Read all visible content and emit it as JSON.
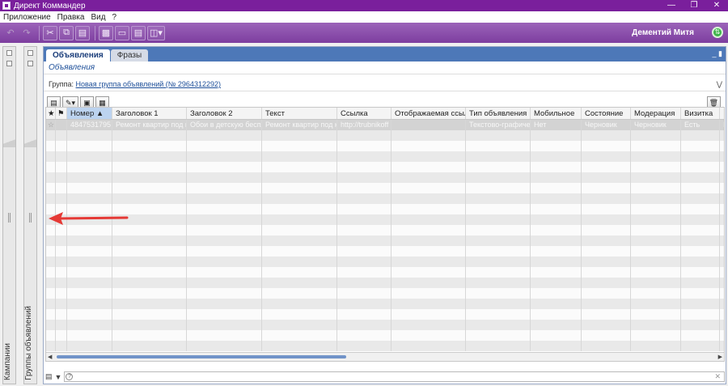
{
  "window": {
    "title": "Директ Коммандер"
  },
  "menu": [
    "Приложение",
    "Правка",
    "Вид",
    "?"
  ],
  "toolbar": {
    "user_name": "Дементий Митя"
  },
  "side_panels": {
    "campaigns_label": "Кампании",
    "groups_label": "Группы объявлений"
  },
  "tabs": [
    {
      "label": "Объявления",
      "active": true
    },
    {
      "label": "Фразы",
      "active": false
    }
  ],
  "subtitle": "Объявления",
  "group": {
    "prefix": "Группа:",
    "name": "Новая группа объявлений (№ 2964312292)"
  },
  "grid": {
    "columns": [
      "",
      "",
      "Номер",
      "Заголовок 1",
      "Заголовок 2",
      "Текст",
      "Ссылка",
      "Отображаемая ссыл...",
      "Тип объявления",
      "Мобильное",
      "Состояние",
      "Модерация",
      "Визитка"
    ],
    "rows": [
      [
        "☆",
        "",
        "4847531795",
        "Ремонт квартир под кл",
        "Обои в детскую бесплт",
        "Ремонт квартир под кл",
        "http://trubnikoff",
        "",
        "Текстово-графичес",
        "Нет",
        "Черновик",
        "Черновик",
        "Есть",
        "Е..."
      ]
    ]
  },
  "colors": {
    "title_bar": "#7a1f9c",
    "toolbar": "#8c4fae",
    "tab_bar": "#4d78b8",
    "arrow": "#e53935"
  }
}
